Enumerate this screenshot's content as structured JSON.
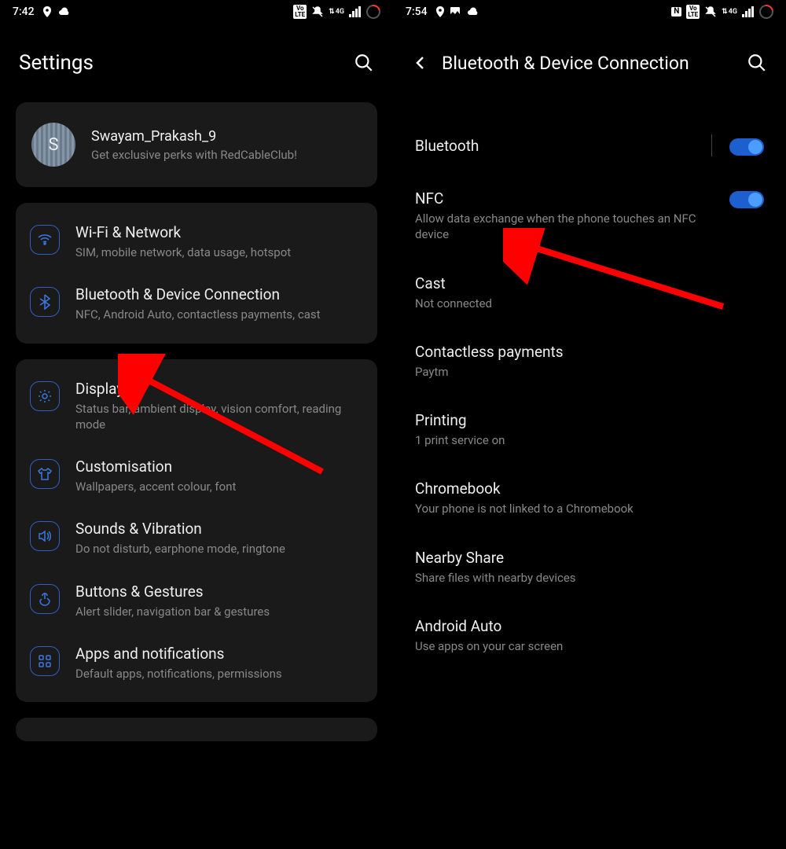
{
  "left": {
    "status": {
      "time": "7:42"
    },
    "header": {
      "title": "Settings"
    },
    "profile": {
      "initial": "S",
      "name": "Swayam_Prakash_9",
      "sub": "Get exclusive perks with RedCableClub!"
    },
    "group1": [
      {
        "icon": "wifi",
        "title": "Wi-Fi & Network",
        "sub": "SIM, mobile network, data usage, hotspot"
      },
      {
        "icon": "bluetooth",
        "title": "Bluetooth & Device Connection",
        "sub": "NFC, Android Auto, contactless payments, cast"
      }
    ],
    "group2": [
      {
        "icon": "brightness",
        "title": "Display",
        "sub": "Status bar, ambient display, vision comfort, reading mode"
      },
      {
        "icon": "shirt",
        "title": "Customisation",
        "sub": "Wallpapers, accent colour, font"
      },
      {
        "icon": "sound",
        "title": "Sounds & Vibration",
        "sub": "Do not disturb, earphone mode, ringtone"
      },
      {
        "icon": "gesture",
        "title": "Buttons & Gestures",
        "sub": "Alert slider, navigation bar & gestures"
      },
      {
        "icon": "apps",
        "title": "Apps and notifications",
        "sub": "Default apps, notifications, permissions"
      }
    ]
  },
  "right": {
    "status": {
      "time": "7:54"
    },
    "header": {
      "title": "Bluetooth & Device Connection"
    },
    "items": [
      {
        "title": "Bluetooth",
        "sub": "",
        "toggle": true,
        "divider": true
      },
      {
        "title": "NFC",
        "sub": "Allow data exchange when the phone touches an NFC device",
        "toggle": true
      },
      {
        "title": "Cast",
        "sub": "Not connected"
      },
      {
        "title": "Contactless payments",
        "sub": "Paytm"
      },
      {
        "title": "Printing",
        "sub": "1 print service on"
      },
      {
        "title": "Chromebook",
        "sub": "Your phone is not linked to a Chromebook"
      },
      {
        "title": "Nearby Share",
        "sub": "Share files with nearby devices"
      },
      {
        "title": "Android Auto",
        "sub": "Use apps on your car screen"
      }
    ]
  },
  "badges": {
    "volte": "Vo\nLTE",
    "signal4g": "4G",
    "nfc": "N"
  }
}
